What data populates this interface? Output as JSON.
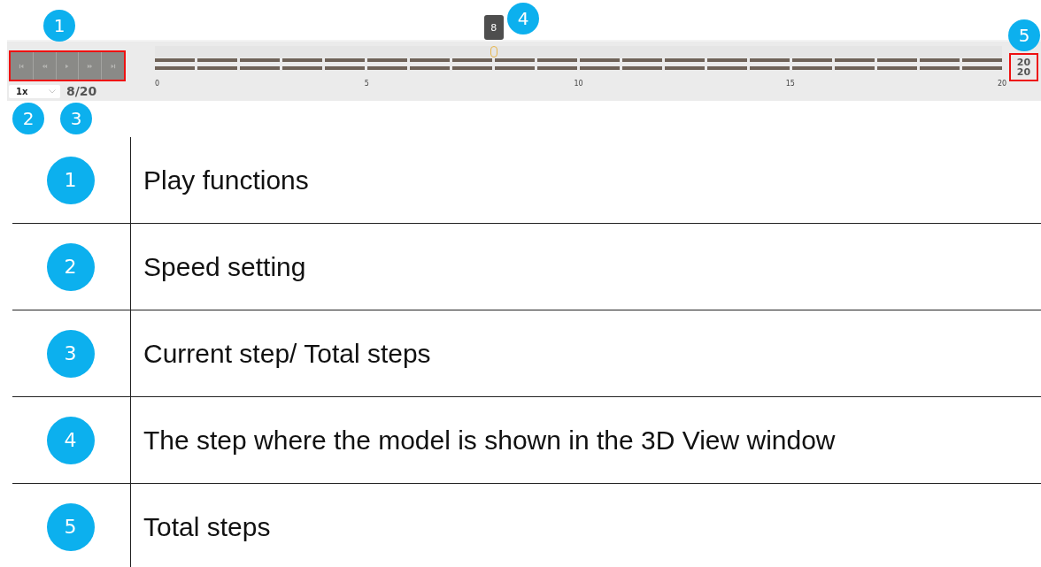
{
  "callouts": [
    {
      "number": "1"
    },
    {
      "number": "2"
    },
    {
      "number": "3"
    },
    {
      "number": "4"
    },
    {
      "number": "5"
    }
  ],
  "player": {
    "buttons": [
      {
        "kind": "first"
      },
      {
        "kind": "previous"
      },
      {
        "kind": "play"
      },
      {
        "kind": "next"
      },
      {
        "kind": "last"
      }
    ],
    "speed": "1x",
    "step_counter": "8/20",
    "timeline": {
      "ticks": [
        "0",
        "5",
        "10",
        "15",
        "20"
      ],
      "current_step": "8",
      "level": 0.4
    },
    "total_steps": [
      "20",
      "20"
    ]
  },
  "legend": [
    {
      "number": "1",
      "description": "Play functions"
    },
    {
      "number": "2",
      "description": "Speed setting"
    },
    {
      "number": "3",
      "description": "Current step/ Total steps"
    },
    {
      "number": "4",
      "description": "The step where the model is shown in the 3D View window"
    },
    {
      "number": "5",
      "description": "Total steps"
    }
  ]
}
